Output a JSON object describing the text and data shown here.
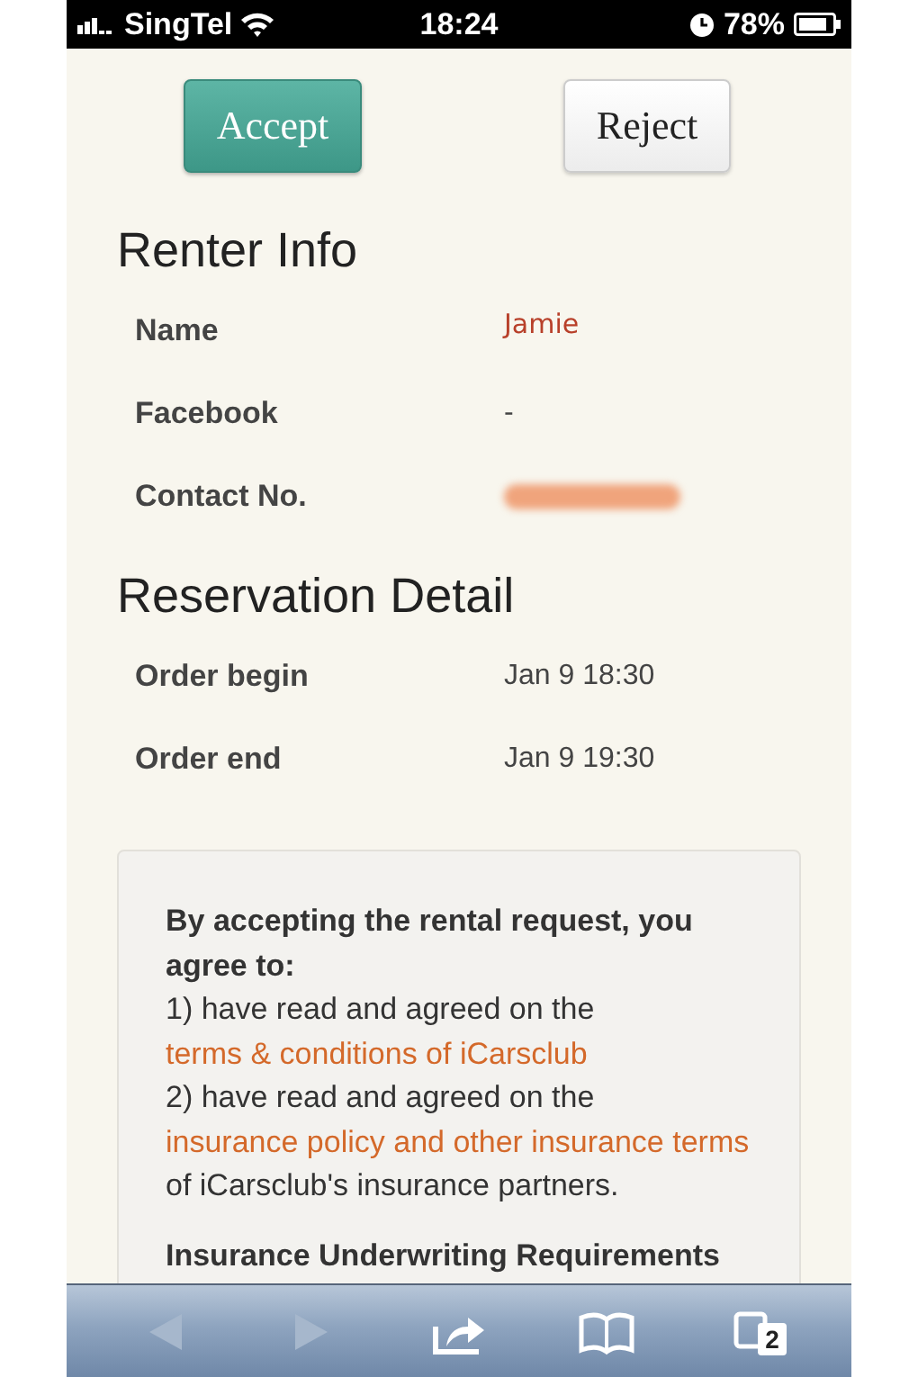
{
  "status_bar": {
    "carrier": "SingTel",
    "time": "18:24",
    "battery": "78%"
  },
  "actions": [
    {
      "label": "Accept",
      "kind": "primary"
    },
    {
      "label": "Reject",
      "kind": "secondary"
    }
  ],
  "sections": [
    {
      "title": "Renter Info",
      "rows": [
        {
          "label": "Name",
          "value": "Jamie",
          "kind": "name"
        },
        {
          "label": "Facebook",
          "value": "-",
          "kind": "plain"
        },
        {
          "label": "Contact No.",
          "kind": "redacted"
        }
      ]
    },
    {
      "title": "Reservation Detail",
      "rows": [
        {
          "label": "Order begin",
          "value": "Jan 9 18:30",
          "kind": "plain"
        },
        {
          "label": "Order end",
          "value": "Jan 9 19:30",
          "kind": "plain"
        }
      ]
    }
  ],
  "terms": {
    "heading": "By accepting the rental request, you agree to:",
    "items": [
      [
        {
          "text": "1) have read and agreed on the ",
          "kind": "text"
        },
        {
          "text": "terms & conditions of iCarsclub",
          "kind": "link"
        }
      ],
      [
        {
          "text": "2) have read and agreed on the ",
          "kind": "text"
        },
        {
          "text": "insurance policy and other insurance terms",
          "kind": "link"
        },
        {
          "text": " of iCarsclub's insurance partners.",
          "kind": "text"
        }
      ]
    ],
    "subheading": "Insurance Underwriting Requirements"
  },
  "toolbar": {
    "buttons": [
      {
        "kind": "back",
        "disabled": true
      },
      {
        "kind": "forward",
        "disabled": true
      },
      {
        "kind": "share",
        "disabled": false
      },
      {
        "kind": "bookmarks",
        "disabled": false
      },
      {
        "kind": "tabs",
        "disabled": false,
        "count": "2"
      }
    ]
  }
}
